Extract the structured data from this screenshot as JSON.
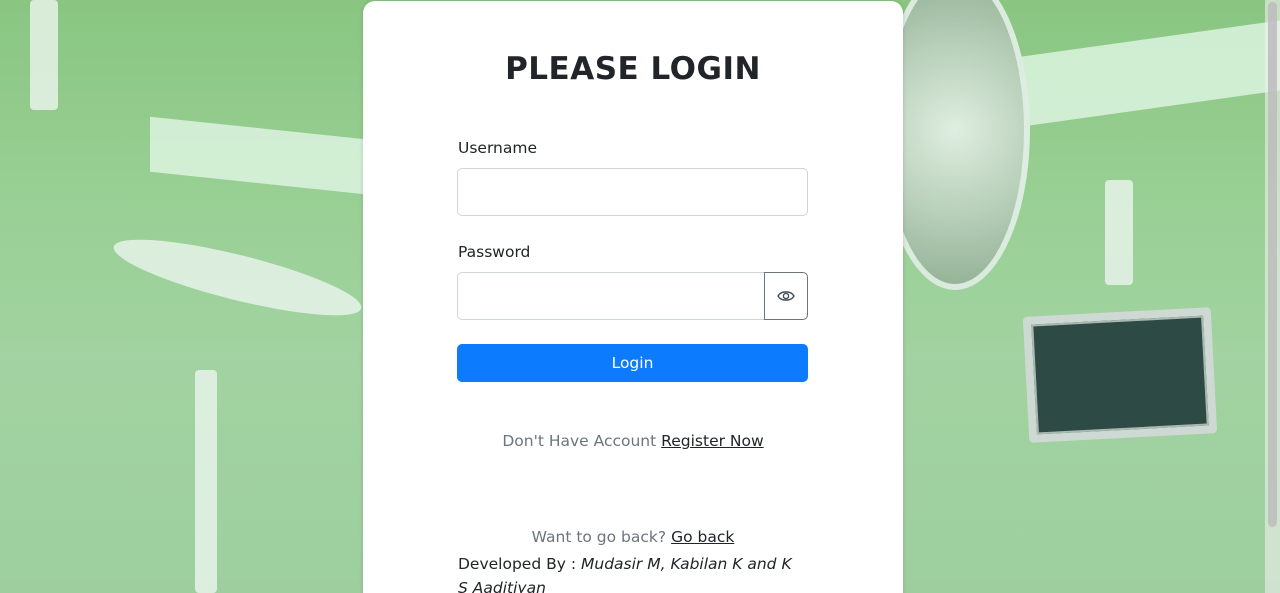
{
  "login": {
    "title": "PLEASE LOGIN",
    "username_label": "Username",
    "username_value": "",
    "password_label": "Password",
    "password_value": "",
    "login_button": "Login"
  },
  "register": {
    "prompt": "Don't Have Account",
    "link": "Register Now"
  },
  "back": {
    "prompt": "Want to go back?",
    "link": "Go back"
  },
  "credits": {
    "label": "Developed By :",
    "names": "Mudasir M, Kabilan K and K S Aaditiyan"
  },
  "icons": {
    "password_toggle": "eye-icon"
  },
  "colors": {
    "primary": "#0d7bfd",
    "background_tint": "#a8cfa8",
    "card": "#ffffff",
    "text": "#212529",
    "muted": "#6c757d"
  }
}
